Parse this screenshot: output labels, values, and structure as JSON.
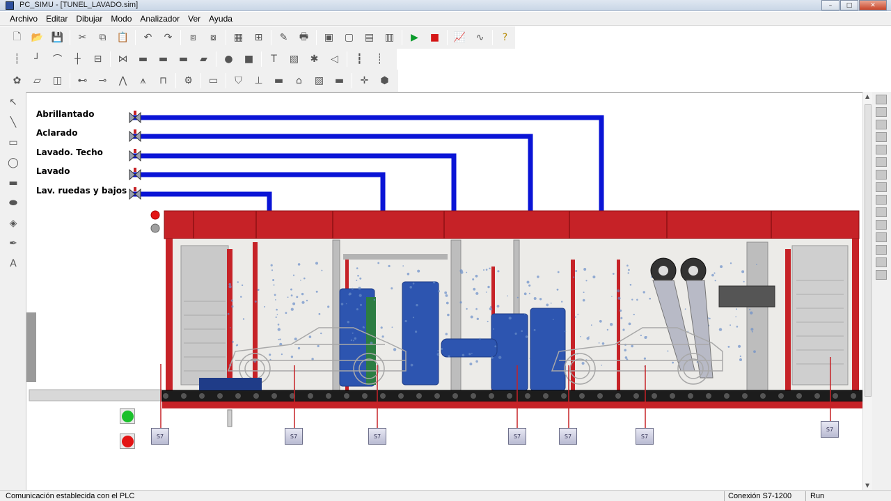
{
  "window": {
    "title": "PC_SIMU - [TUNEL_LAVADO.sim]"
  },
  "menu": [
    "Archivo",
    "Editar",
    "Dibujar",
    "Modo",
    "Analizador",
    "Ver",
    "Ayuda"
  ],
  "toolbar1": [
    "new-file-icon",
    "open-file-icon",
    "save-icon",
    "sep",
    "cut-icon",
    "copy-icon",
    "paste-icon",
    "sep",
    "undo-icon",
    "redo-icon",
    "sep",
    "bring-front-icon",
    "send-back-icon",
    "sep",
    "grid-icon",
    "snap-grid-icon",
    "sep",
    "pencil-icon",
    "print-preview-icon",
    "sep",
    "panel-1-icon",
    "panel-2-icon",
    "panel-3-icon",
    "panel-4-icon",
    "sep",
    "run-icon",
    "stop-icon",
    "sep",
    "chart-icon",
    "analyzer-icon",
    "sep",
    "help-icon"
  ],
  "toolbar2": [
    "pipe-vertical-icon",
    "pipe-elbow-icon",
    "pipe-curve-icon",
    "pipe-cross-icon",
    "tank-icon",
    "sep",
    "valve-icon",
    "rect-pump-icon",
    "block-icon",
    "block2-icon",
    "motor-icon",
    "sep",
    "circle-icon",
    "square-icon",
    "sep",
    "text-icon",
    "image-icon",
    "fan-icon",
    "speaker-icon",
    "sep",
    "slider-icon",
    "slider2-icon"
  ],
  "toolbar3": [
    "blob-icon",
    "conveyor-icon",
    "roller-icon",
    "sep",
    "piston-icon",
    "cylinder-icon",
    "tripod-icon",
    "stand-icon",
    "clamp-icon",
    "sep",
    "gear-cloud-icon",
    "sep",
    "display-icon",
    "sep",
    "shield-icon",
    "pump-valve-icon",
    "bar-icon",
    "factory-icon",
    "hatch-icon",
    "bar2-icon",
    "sep",
    "cross-icon",
    "hexagon-icon"
  ],
  "left_tools": [
    "pointer-icon",
    "line-icon",
    "rectangle-icon",
    "ellipse-icon",
    "filled-rect-icon",
    "filled-ellipse-icon",
    "fill-bucket-icon",
    "pen-icon",
    "text-tool-icon"
  ],
  "pipes": [
    {
      "label": "Abrillantado",
      "color": "#0a14d6"
    },
    {
      "label": "Aclarado",
      "color": "#0a14d6"
    },
    {
      "label": "Lavado. Techo",
      "color": "#0a14d6"
    },
    {
      "label": "Lavado",
      "color": "#0a14d6"
    },
    {
      "label": "Lav. ruedas y bajos",
      "color": "#0a14d6"
    }
  ],
  "sensor_label": "S7",
  "colors": {
    "frame_red": "#c62227",
    "pipe_blue": "#0a14d6",
    "brush_blue": "#2d55b0",
    "lamp_green": "#19c02a",
    "lamp_red": "#e31414"
  },
  "status": {
    "message": "Comunicación establecida con el PLC",
    "connection": "Conexión S7-1200",
    "mode": "Run"
  }
}
